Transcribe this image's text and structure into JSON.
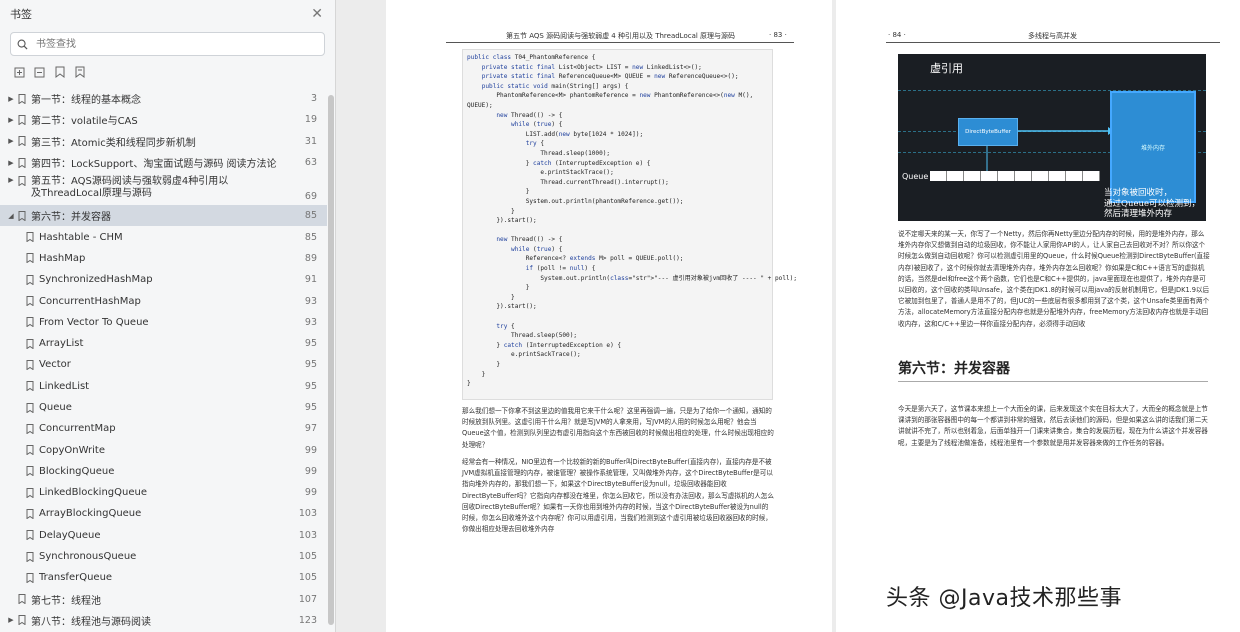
{
  "sidebar": {
    "title": "书签",
    "search_placeholder": "书签查找",
    "items": [
      {
        "label": "第一节：线程的基本概念",
        "page": "3",
        "level": 1,
        "expandable": true
      },
      {
        "label": "第二节：volatile与CAS",
        "page": "19",
        "level": 1,
        "expandable": true
      },
      {
        "label": "第三节：Atomic类和线程同步新机制",
        "page": "31",
        "level": 1,
        "expandable": true
      },
      {
        "label": "第四节：LockSupport、淘宝面试题与源码  阅读方法论",
        "page": "63",
        "level": 1,
        "expandable": true
      },
      {
        "label": "第五节：AQS源码阅读与强软弱虚4种引用以  及ThreadLocal原理与源码",
        "page": "69",
        "level": 1,
        "expandable": true
      },
      {
        "label": "第六节：并发容器",
        "page": "85",
        "level": 1,
        "expandable": true,
        "expanded": true,
        "selected": true
      },
      {
        "label": "Hashtable - CHM",
        "page": "85",
        "level": 2
      },
      {
        "label": "HashMap",
        "page": "89",
        "level": 2
      },
      {
        "label": "SynchronizedHashMap",
        "page": "91",
        "level": 2
      },
      {
        "label": "ConcurrentHashMap",
        "page": "93",
        "level": 2
      },
      {
        "label": "From Vector To Queue",
        "page": "93",
        "level": 2
      },
      {
        "label": "ArrayList",
        "page": "95",
        "level": 2
      },
      {
        "label": "Vector",
        "page": "95",
        "level": 2
      },
      {
        "label": "LinkedList",
        "page": "95",
        "level": 2
      },
      {
        "label": "Queue",
        "page": "95",
        "level": 2
      },
      {
        "label": "ConcurrentMap",
        "page": "97",
        "level": 2
      },
      {
        "label": "CopyOnWrite",
        "page": "99",
        "level": 2
      },
      {
        "label": "BlockingQueue",
        "page": "99",
        "level": 2
      },
      {
        "label": "LinkedBlockingQueue",
        "page": "99",
        "level": 2
      },
      {
        "label": "ArrayBlockingQueue",
        "page": "103",
        "level": 2
      },
      {
        "label": "DelayQueue",
        "page": "103",
        "level": 2
      },
      {
        "label": "SynchronousQueue",
        "page": "105",
        "level": 2
      },
      {
        "label": "TransferQueue",
        "page": "105",
        "level": 2
      },
      {
        "label": "第七节：线程池",
        "page": "107",
        "level": 1,
        "expandable": false
      },
      {
        "label": "第八节：线程池与源码阅读",
        "page": "123",
        "level": 1,
        "expandable": true
      }
    ]
  },
  "left_page": {
    "header_title": "第五节  AQS 源码阅读与强软弱虚 4 种引用以及 ThreadLocal 原理与源码",
    "header_page": "· 83 ·",
    "code_lines": [
      "public class T04_PhantomReference {",
      "    private static final List<Object> LIST = new LinkedList<>();",
      "    private static final ReferenceQueue<M> QUEUE = new ReferenceQueue<>();",
      "    public static void main(String[] args) {",
      "        PhantomReference<M> phantomReference = new PhantomReference<>(new M(),",
      "QUEUE);",
      "        new Thread(() -> {",
      "            while (true) {",
      "                LIST.add(new byte[1024 * 1024]);",
      "                try {",
      "                    Thread.sleep(1000);",
      "                } catch (InterruptedException e) {",
      "                    e.printStackTrace();",
      "                    Thread.currentThread().interrupt();",
      "                }",
      "                System.out.println(phantomReference.get());",
      "            }",
      "        }).start();",
      "",
      "        new Thread(() -> {",
      "            while (true) {",
      "                Reference<? extends M> poll = QUEUE.poll();",
      "                if (poll != null) {",
      "                    System.out.println(\"--- 虚引用对象被jvm回收了 ---- \" + poll);",
      "                }",
      "            }",
      "        }).start();",
      "",
      "        try {",
      "            Thread.sleep(500);",
      "        } catch (InterruptedException e) {",
      "            e.printSackTrace();",
      "        }",
      "    }",
      "}"
    ],
    "para1": "那么我们想一下你拿不到这里边的值我用它来干什么呢？这里再强调一遍，只是为了给你一个通知，通知的时候放到队列里。这虚引用干什么用？就是写JVM的人拿来用，写JVM的人用的时候怎么用呢？他会当Queue这个值，检测到队列里边有虚引用指向这个东西被回收的时候做出相应的处理，什么时候出现相应的处理呢？",
    "para2": "经常会有一种情况，NIO里边有一个比较新的新的Buffer叫DirectByteBuffer(直接内存)，直接内存是不被JVM虚拟机直接管理的内存，被谁管理？被操作系统管理，又叫做堆外内存，这个DirectByteBuffer是可以指向堆外内存的，那我们想一下，如果这个DirectByteBuffer设为null，垃圾回收器能回收DirectByteBuffer吗？它指向内存都没在堆里，你怎么回收它，所以没有办法回收，那么写虚拟机的人怎么回收DirectByteBuffer呢？如果有一天你也用到堆外内存的时候，当这个DirectByteBuffer被设为null的时候，你怎么回收堆外这个内存呢？你可以用虚引用，当我们检测到这个虚引用被垃圾回收器回收的时候，你做出相应处理去回收堆外内存"
  },
  "right_page": {
    "header_page": "· 84 ·",
    "header_title": "多线程与高并发",
    "figure": {
      "title": "虚引用",
      "box_dbb": "DirectByteBuffer",
      "box_heap": "堆外内存",
      "queue_label": "Queue",
      "queue_slots": 10,
      "note": "当对象被回收时，\n通过Queue可以检测到，\n然后清理堆外内存"
    },
    "para1": "说不定哪天来的某一天，你写了一个Netty，然后你再Netty里边分配内存的时候，用的是堆外内存，那么堆外内存你又想做到自动的垃圾回收，你不能让人家用你API的人，让人家自己去回收对不对？所以你这个时候怎么做到自动回收呢？你可以检测虚引用里的Queue，什么时候Queue检测到DirectByteBuffer(直接内存)被回收了，这个时候你就去清理堆外内存，堆外内存怎么回收呢？你如果是C和C++语言写的虚拟机的话，当然是del和free这个两个函数，它们也是C和C++提供的，java里面现在也提供了，堆外内存是可以回收的，这个回收的类叫Unsafe，这个类在JDK1.8的时候可以用java的反射机制用它，但是JDK1.9以后它被加到包里了，普通人是用不了的，但JUC的一些底层有很多都用到了这个类，这个Unsafe类里面有两个方法，allocateMemory方法直接分配内存也就是分配堆外内存，freeMemory方法回收内存也就是手动回收内存，这和C/C++里边一样你直接分配内存，必须得手动回收",
    "section_title": "第六节：并发容器",
    "para2": "今天是第六天了，这节课本来想上一个大而全的课，后来发现这个实在目标太大了，大而全的概念就是上节课讲到的那张容器图中的每一个都讲到非常的细致，然后去读他们的源码，但是如果这么讲的话我们第二天讲就讲不完了，所以也别着急，后面单独开一门课来讲集合，集合的发展历程，现在为什么讲这个并发容器呢，主要是为了线程池做准备，线程池里有一个参数就是用并发容器来做的工作任务的容器。"
  },
  "watermark": "头条 @Java技术那些事"
}
